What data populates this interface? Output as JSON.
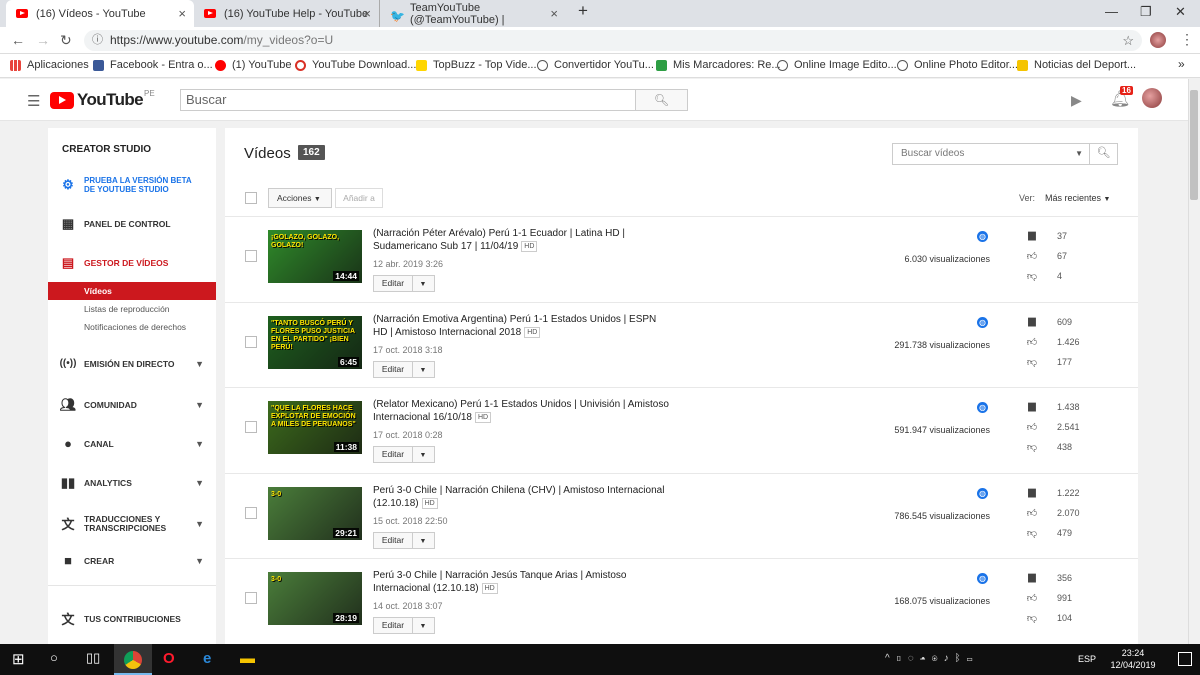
{
  "browser": {
    "tabs": [
      {
        "title": "(16) Vídeos - YouTube",
        "active": true,
        "icon": "youtube-icon"
      },
      {
        "title": "(16) YouTube Help - YouTube",
        "active": false,
        "icon": "youtube-icon"
      },
      {
        "title": "TeamYouTube (@TeamYouTube) |",
        "active": false,
        "icon": "twitter-icon"
      }
    ],
    "url_host": "https://www.youtube.com",
    "url_path": "/my_videos?o=U",
    "bookmarks": [
      {
        "label": "Aplicaciones",
        "icon": "apps-grid-icon",
        "color": "#e8453c"
      },
      {
        "label": "Facebook - Entra o...",
        "icon": "facebook-icon",
        "color": "#3b5998"
      },
      {
        "label": "(1) YouTube",
        "icon": "youtube-icon",
        "color": "#ff0000"
      },
      {
        "label": "YouTube Download...",
        "icon": "download-icon",
        "color": "#d93025"
      },
      {
        "label": "TopBuzz - Top Vide...",
        "icon": "topbuzz-icon",
        "color": "#ffd600"
      },
      {
        "label": "Convertidor YouTu...",
        "icon": "convert-icon",
        "color": "#555555"
      },
      {
        "label": "Mis Marcadores: Re...",
        "icon": "marcadores-icon",
        "color": "#2e9e44"
      },
      {
        "label": "Online Image Edito...",
        "icon": "image-editor-icon",
        "color": "#555555"
      },
      {
        "label": "Online Photo Editor...",
        "icon": "photo-editor-icon",
        "color": "#555555"
      },
      {
        "label": "Noticias del Deport...",
        "icon": "news-icon",
        "color": "#f5c400"
      }
    ]
  },
  "header": {
    "logo_text": "YouTube",
    "country": "PE",
    "search_placeholder": "Buscar",
    "notifications": "16"
  },
  "sidebar": {
    "title": "CREATOR STUDIO",
    "beta": "PRUEBA LA VERSIÓN BETA DE YOUTUBE STUDIO",
    "items": [
      {
        "label": "PANEL DE CONTROL",
        "icon": "dashboard-icon"
      },
      {
        "label": "GESTOR DE VÍDEOS",
        "icon": "video-manager-icon"
      },
      {
        "label": "EMISIÓN EN DIRECTO",
        "icon": "live-icon"
      },
      {
        "label": "COMUNIDAD",
        "icon": "community-icon"
      },
      {
        "label": "CANAL",
        "icon": "channel-icon"
      },
      {
        "label": "ANALYTICS",
        "icon": "analytics-icon"
      },
      {
        "label": "TRADUCCIONES Y TRANSCRIPCIONES",
        "icon": "translate-icon"
      },
      {
        "label": "CREAR",
        "icon": "create-icon"
      },
      {
        "label": "TUS CONTRIBUCIONES",
        "icon": "contributions-icon"
      }
    ],
    "sub_items": [
      "Vídeos",
      "Listas de reproducción",
      "Notificaciones de derechos"
    ]
  },
  "main": {
    "title": "Vídeos",
    "count": "162",
    "search_placeholder": "Buscar vídeos",
    "actions_label": "Acciones",
    "add_to_label": "Añadir a",
    "view_label": "Ver:",
    "sort_label": "Más recientes",
    "edit_label": "Editar",
    "hd_label": "HD",
    "videos": [
      {
        "title": "(Narración Péter Arévalo) Perú 1-1 Ecuador | Latina HD | Sudamericano Sub 17 | 11/04/19",
        "date": "12 abr. 2019 3:26",
        "duration": "14:44",
        "views": "6.030 visualizaciones",
        "comments": "37",
        "likes": "67",
        "dislikes": "4",
        "thumb_text": "¡GOLAZO, GOLAZO, GOLAZO!",
        "thumb_bg": "#2f8a2a"
      },
      {
        "title": "(Narración Emotiva Argentina) Perú 1-1 Estados Unidos | ESPN HD | Amistoso Internacional 2018",
        "date": "17 oct. 2018 3:18",
        "duration": "6:45",
        "views": "291.738 visualizaciones",
        "comments": "609",
        "likes": "1.426",
        "dislikes": "177",
        "thumb_text": "\"TANTO BUSCÓ PERÚ Y FLORES PUSO JUSTICIA EN EL PARTIDO\"  ¡BIEN PERÚ!",
        "thumb_bg": "#1e5f1e"
      },
      {
        "title": "(Relator Mexicano) Perú 1-1 Estados Unidos | Univisión | Amistoso Internacional 16/10/18",
        "date": "17 oct. 2018 0:28",
        "duration": "11:38",
        "views": "591.947 visualizaciones",
        "comments": "1.438",
        "likes": "2.541",
        "dislikes": "438",
        "thumb_text": "\"QUE LA FLORES HACE EXPLOTAR DE EMOCIÓN A MILES DE PERUANOS\"",
        "thumb_bg": "#3c6b1c"
      },
      {
        "title": "Perú 3-0 Chile | Narración Chilena (CHV) | Amistoso Internacional (12.10.18)",
        "date": "15 oct. 2018 22:50",
        "duration": "29:21",
        "views": "786.545 visualizaciones",
        "comments": "1.222",
        "likes": "2.070",
        "dislikes": "479",
        "thumb_text": "3-0",
        "thumb_bg": "#4a7d3a"
      },
      {
        "title": "Perú 3-0 Chile | Narración Jesús Tanque Arias | Amistoso Internacional (12.10.18)",
        "date": "14 oct. 2018 3:07",
        "duration": "28:19",
        "views": "168.075 visualizaciones",
        "comments": "356",
        "likes": "991",
        "dislikes": "104",
        "thumb_text": "3-0",
        "thumb_bg": "#4a7d3a"
      }
    ]
  },
  "taskbar": {
    "language": "ESP",
    "time": "23:24",
    "date": "12/04/2019"
  }
}
